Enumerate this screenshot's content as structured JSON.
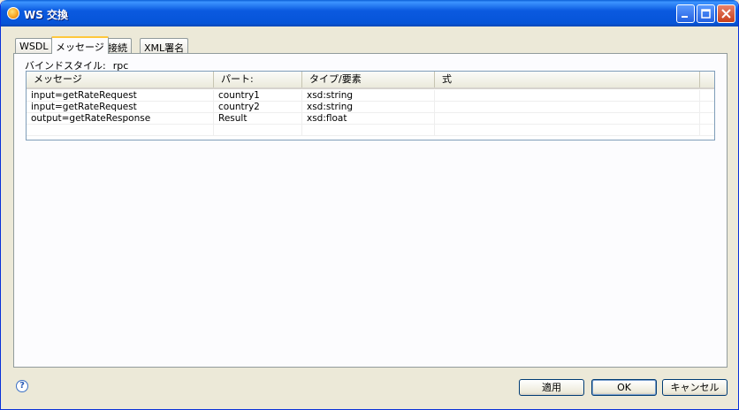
{
  "window": {
    "title": "WS 交換"
  },
  "tabs": [
    {
      "label": "WSDL"
    },
    {
      "label": "メッセージ"
    },
    {
      "label": "接続"
    },
    {
      "label": "XML署名"
    }
  ],
  "binding": {
    "label": "バインドスタイル:",
    "value": "rpc"
  },
  "table": {
    "columns": [
      "メッセージ",
      "パート:",
      "タイプ/要素",
      "式"
    ],
    "rows": [
      [
        "input=getRateRequest",
        "country1",
        "xsd:string",
        ""
      ],
      [
        "input=getRateRequest",
        "country2",
        "xsd:string",
        ""
      ],
      [
        "output=getRateResponse",
        "Result",
        "xsd:float",
        ""
      ],
      [
        "",
        "",
        "",
        ""
      ]
    ]
  },
  "buttons": {
    "apply": "適用",
    "ok": "OK",
    "cancel": "キャンセル"
  },
  "help": {
    "glyph": "?"
  },
  "colors": {
    "titlebar": "#0654d8",
    "dialog_bg": "#ece9d8",
    "tab_highlight": "#ffc83c"
  }
}
